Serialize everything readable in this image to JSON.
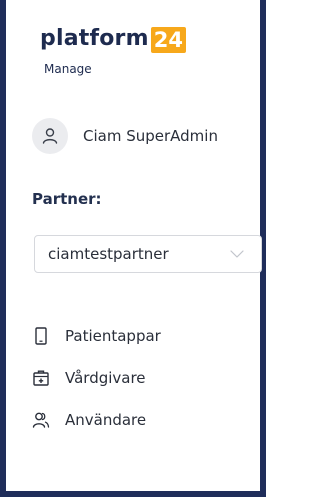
{
  "brand": {
    "name": "platform",
    "badge": "24",
    "subtitle": "Manage",
    "badge_color": "#f7a81b",
    "text_color": "#1e2b4f"
  },
  "user": {
    "name": "Ciam SuperAdmin",
    "icon": "user-icon"
  },
  "partner": {
    "label": "Partner:",
    "selected": "ciamtestpartner",
    "icon": "chevron-down-icon"
  },
  "nav": {
    "items": [
      {
        "label": "Patientappar",
        "icon": "mobile-icon"
      },
      {
        "label": "Vårdgivare",
        "icon": "medical-kit-icon"
      },
      {
        "label": "Användare",
        "icon": "users-icon"
      }
    ]
  },
  "colors": {
    "frame": "#1f2d5a"
  }
}
